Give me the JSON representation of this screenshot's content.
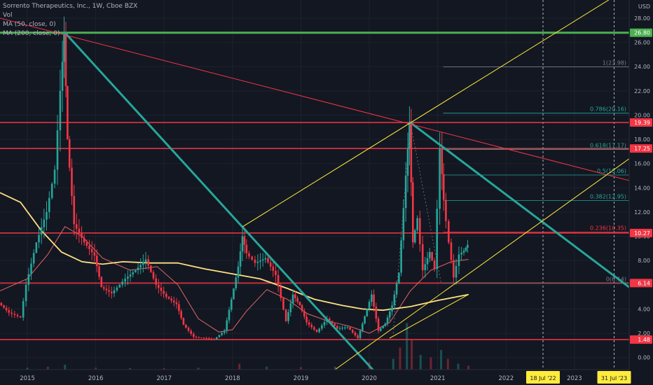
{
  "chart_data": {
    "type": "candlestick",
    "legend": {
      "title": "Sorrento Therapeutics, Inc., 1W, Cboe BZX",
      "lines": [
        "Vol",
        "MA (50, close, 0)",
        "MA (200, close, 0)"
      ]
    },
    "currency": "USD",
    "y_range": [
      -1,
      29.5
    ],
    "y_ticks": [
      0,
      2,
      4,
      6,
      8,
      10,
      12,
      14,
      16,
      18,
      20,
      22,
      24,
      26,
      28
    ],
    "y_tick_labels": [
      "0.00",
      "2.00",
      "4.00",
      "6.00",
      "8.00",
      "10.00",
      "12.00",
      "14.00",
      "16.00",
      "18.00",
      "20.00",
      "22.00",
      "24.00",
      "26.00",
      "28.00"
    ],
    "x_range": [
      2014.6,
      2023.8
    ],
    "x_ticks": [
      {
        "x": 2015,
        "label": "2015"
      },
      {
        "x": 2016,
        "label": "2016"
      },
      {
        "x": 2017,
        "label": "2017"
      },
      {
        "x": 2018,
        "label": "2018"
      },
      {
        "x": 2019,
        "label": "2019"
      },
      {
        "x": 2020,
        "label": "2020"
      },
      {
        "x": 2021,
        "label": "2021"
      },
      {
        "x": 2022,
        "label": "2022"
      },
      {
        "x": 2023,
        "label": "2023"
      }
    ],
    "date_markers": [
      {
        "x": 2022.54,
        "label": "18 Jul '22"
      },
      {
        "x": 2023.58,
        "label": "31 Jul '23"
      }
    ],
    "horizontal_levels": [
      {
        "price": 26.8,
        "label": "26.80",
        "color": "#4caf50"
      },
      {
        "price": 19.39,
        "label": "19.39",
        "color": "#f23645"
      },
      {
        "price": 17.25,
        "label": "17.25",
        "color": "#f23645"
      },
      {
        "price": 10.27,
        "label": "10.27",
        "color": "#f23645"
      },
      {
        "price": 6.14,
        "label": "6.14",
        "color": "#f23645"
      },
      {
        "price": 1.48,
        "label": "1.48",
        "color": "#f23645"
      }
    ],
    "fib_levels": [
      {
        "ratio": "1",
        "price": 23.98,
        "label": "1(23.98)",
        "color": "#787b86"
      },
      {
        "ratio": "0.786",
        "price": 20.16,
        "label": "0.786(20.16)",
        "color": "#26a69a"
      },
      {
        "ratio": "0.618",
        "price": 17.17,
        "label": "0.618(17.17)",
        "color": "#26a69a"
      },
      {
        "ratio": "0.5",
        "price": 15.06,
        "label": "0.5(15.06)",
        "color": "#26a69a"
      },
      {
        "ratio": "0.382",
        "price": 12.95,
        "label": "0.382(12.95)",
        "color": "#26a69a"
      },
      {
        "ratio": "0.236",
        "price": 10.35,
        "label": "0.236(10.35)",
        "color": "#f23645"
      },
      {
        "ratio": "0",
        "price": 6.14,
        "label": "0(6.14)",
        "color": "#787b86"
      }
    ],
    "trendlines": [
      {
        "name": "teal-downtrend-1",
        "color": "#26a69a",
        "width": 3,
        "points": [
          [
            2015.55,
            26.8
          ],
          [
            2020.05,
            -1.0
          ]
        ]
      },
      {
        "name": "teal-downtrend-2",
        "color": "#26a69a",
        "width": 3,
        "points": [
          [
            2020.6,
            19.39
          ],
          [
            2023.8,
            5.8
          ]
        ]
      },
      {
        "name": "red-downtrend",
        "color": "#f23645",
        "width": 1,
        "points": [
          [
            2014.6,
            28.0
          ],
          [
            2023.8,
            14.6
          ]
        ]
      },
      {
        "name": "yellow-channel-upper",
        "color": "#ffeb3b",
        "width": 1,
        "points": [
          [
            2018.15,
            10.8
          ],
          [
            2023.5,
            29.5
          ]
        ]
      },
      {
        "name": "yellow-channel-lower",
        "color": "#ffeb3b",
        "width": 1,
        "points": [
          [
            2019.5,
            -1.0
          ],
          [
            2023.8,
            16.4
          ]
        ]
      },
      {
        "name": "yellow-trendline-short",
        "color": "#ffeb3b",
        "width": 1,
        "points": [
          [
            2020.3,
            1.6
          ],
          [
            2021.45,
            5.2
          ]
        ]
      }
    ],
    "series": [
      {
        "name": "MA (50, close, 0)",
        "color": "#e06666",
        "points": [
          [
            2014.6,
            5.5
          ],
          [
            2015.0,
            6.5
          ],
          [
            2015.3,
            8.5
          ],
          [
            2015.55,
            10.8
          ],
          [
            2015.8,
            10.0
          ],
          [
            2016.1,
            8.2
          ],
          [
            2016.5,
            7.2
          ],
          [
            2016.9,
            7.5
          ],
          [
            2017.2,
            6.0
          ],
          [
            2017.5,
            3.2
          ],
          [
            2017.8,
            2.1
          ],
          [
            2018.0,
            2.3
          ],
          [
            2018.2,
            3.8
          ],
          [
            2018.5,
            5.6
          ],
          [
            2018.8,
            4.8
          ],
          [
            2019.1,
            3.6
          ],
          [
            2019.4,
            3.0
          ],
          [
            2019.7,
            2.6
          ],
          [
            2020.0,
            2.0
          ],
          [
            2020.3,
            2.9
          ],
          [
            2020.6,
            5.5
          ],
          [
            2020.9,
            7.2
          ],
          [
            2021.2,
            7.9
          ],
          [
            2021.45,
            8.1
          ]
        ]
      },
      {
        "name": "MA (200, close, 0)",
        "color": "#ffe082",
        "points": [
          [
            2014.6,
            13.6
          ],
          [
            2014.9,
            12.8
          ],
          [
            2015.2,
            10.5
          ],
          [
            2015.5,
            8.7
          ],
          [
            2015.8,
            7.9
          ],
          [
            2016.1,
            7.7
          ],
          [
            2016.4,
            7.9
          ],
          [
            2016.8,
            7.8
          ],
          [
            2017.2,
            7.8
          ],
          [
            2017.6,
            7.3
          ],
          [
            2018.0,
            6.9
          ],
          [
            2018.4,
            6.5
          ],
          [
            2018.8,
            5.7
          ],
          [
            2019.2,
            4.8
          ],
          [
            2019.6,
            4.3
          ],
          [
            2019.9,
            4.0
          ],
          [
            2020.2,
            3.9
          ],
          [
            2020.6,
            4.2
          ],
          [
            2021.0,
            4.7
          ],
          [
            2021.45,
            5.2
          ]
        ]
      }
    ],
    "price_path": [
      [
        2014.6,
        4.5
      ],
      [
        2014.75,
        3.7
      ],
      [
        2014.92,
        3.3
      ],
      [
        2015.0,
        6.0
      ],
      [
        2015.15,
        9.5
      ],
      [
        2015.3,
        12.0
      ],
      [
        2015.42,
        15.5
      ],
      [
        2015.5,
        22.0
      ],
      [
        2015.55,
        26.8
      ],
      [
        2015.6,
        18.0
      ],
      [
        2015.7,
        11.0
      ],
      [
        2015.85,
        9.5
      ],
      [
        2016.0,
        8.4
      ],
      [
        2016.1,
        5.8
      ],
      [
        2016.25,
        5.3
      ],
      [
        2016.45,
        6.5
      ],
      [
        2016.6,
        7.2
      ],
      [
        2016.75,
        8.1
      ],
      [
        2016.9,
        6.0
      ],
      [
        2017.05,
        5.0
      ],
      [
        2017.2,
        4.4
      ],
      [
        2017.3,
        2.7
      ],
      [
        2017.45,
        1.7
      ],
      [
        2017.6,
        1.6
      ],
      [
        2017.75,
        1.5
      ],
      [
        2017.9,
        2.2
      ],
      [
        2018.0,
        4.8
      ],
      [
        2018.1,
        7.5
      ],
      [
        2018.16,
        10.0
      ],
      [
        2018.22,
        8.6
      ],
      [
        2018.35,
        7.8
      ],
      [
        2018.5,
        8.2
      ],
      [
        2018.65,
        6.8
      ],
      [
        2018.8,
        3.0
      ],
      [
        2018.9,
        5.2
      ],
      [
        2019.0,
        4.3
      ],
      [
        2019.1,
        2.9
      ],
      [
        2019.25,
        2.1
      ],
      [
        2019.4,
        3.2
      ],
      [
        2019.55,
        2.4
      ],
      [
        2019.7,
        2.5
      ],
      [
        2019.85,
        1.6
      ],
      [
        2019.95,
        3.4
      ],
      [
        2020.05,
        5.2
      ],
      [
        2020.15,
        2.2
      ],
      [
        2020.25,
        2.8
      ],
      [
        2020.35,
        4.3
      ],
      [
        2020.45,
        7.0
      ],
      [
        2020.55,
        15.0
      ],
      [
        2020.6,
        19.39
      ],
      [
        2020.65,
        9.5
      ],
      [
        2020.72,
        11.5
      ],
      [
        2020.8,
        7.2
      ],
      [
        2020.9,
        8.7
      ],
      [
        2020.97,
        7.3
      ],
      [
        2021.05,
        17.25
      ],
      [
        2021.1,
        13.0
      ],
      [
        2021.18,
        9.5
      ],
      [
        2021.25,
        6.6
      ],
      [
        2021.33,
        8.5
      ],
      [
        2021.4,
        8.8
      ],
      [
        2021.45,
        9.3
      ]
    ],
    "volume": {
      "scale_max": 100,
      "bars": [
        [
          2015.0,
          4
        ],
        [
          2015.3,
          6
        ],
        [
          2015.55,
          10
        ],
        [
          2016.0,
          4
        ],
        [
          2016.5,
          3
        ],
        [
          2017.0,
          3
        ],
        [
          2017.5,
          4
        ],
        [
          2018.1,
          12
        ],
        [
          2018.5,
          6
        ],
        [
          2019.0,
          5
        ],
        [
          2019.5,
          6
        ],
        [
          2020.0,
          15
        ],
        [
          2020.35,
          22
        ],
        [
          2020.45,
          45
        ],
        [
          2020.55,
          95
        ],
        [
          2020.62,
          60
        ],
        [
          2020.75,
          30
        ],
        [
          2020.9,
          25
        ],
        [
          2021.05,
          40
        ],
        [
          2021.15,
          22
        ],
        [
          2021.3,
          12
        ],
        [
          2021.45,
          8
        ]
      ]
    }
  }
}
